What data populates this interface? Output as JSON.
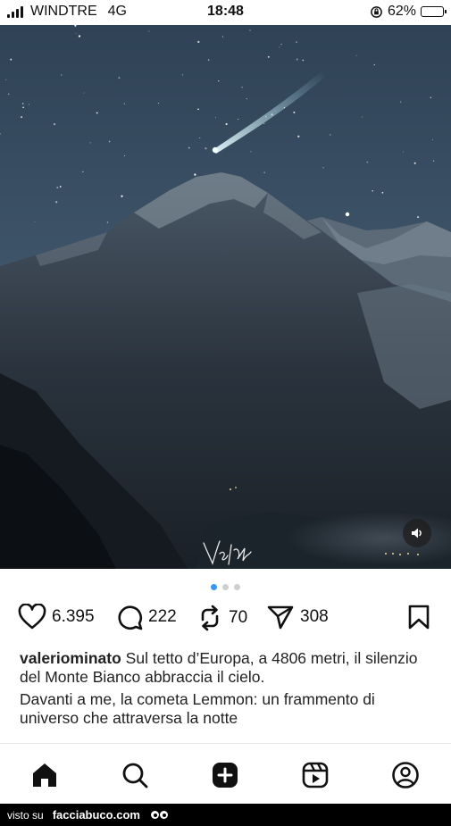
{
  "status_bar": {
    "carrier": "WINDTRE",
    "network": "4G",
    "time": "18:48",
    "battery_percent": "62%",
    "battery_level": 0.62
  },
  "post": {
    "photo_signature": "Valerio Minato",
    "carousel": {
      "count": 3,
      "active_index": 0
    },
    "likes": "6.395",
    "comments": "222",
    "reposts": "70",
    "shares": "308",
    "caption": {
      "username": "valeriominato",
      "text_line1": "Sul tetto d’Europa, a 4806 metri, il silenzio del Monte Bianco abbraccia il cielo.",
      "text_line2": "Davanti a me, la cometa Lemmon: un frammento di universo che attraversa la notte"
    }
  },
  "nav": {
    "items": [
      "home-icon",
      "search-icon",
      "create-icon",
      "reels-icon",
      "profile-icon"
    ]
  },
  "watermark": {
    "prefix": "visto su",
    "site": "facciabuco.com"
  },
  "colors": {
    "accent_dot": "#3897f0",
    "battery_fill": "#f5c518",
    "sky_top": "#33465a",
    "sky_bottom": "#4a6075"
  }
}
